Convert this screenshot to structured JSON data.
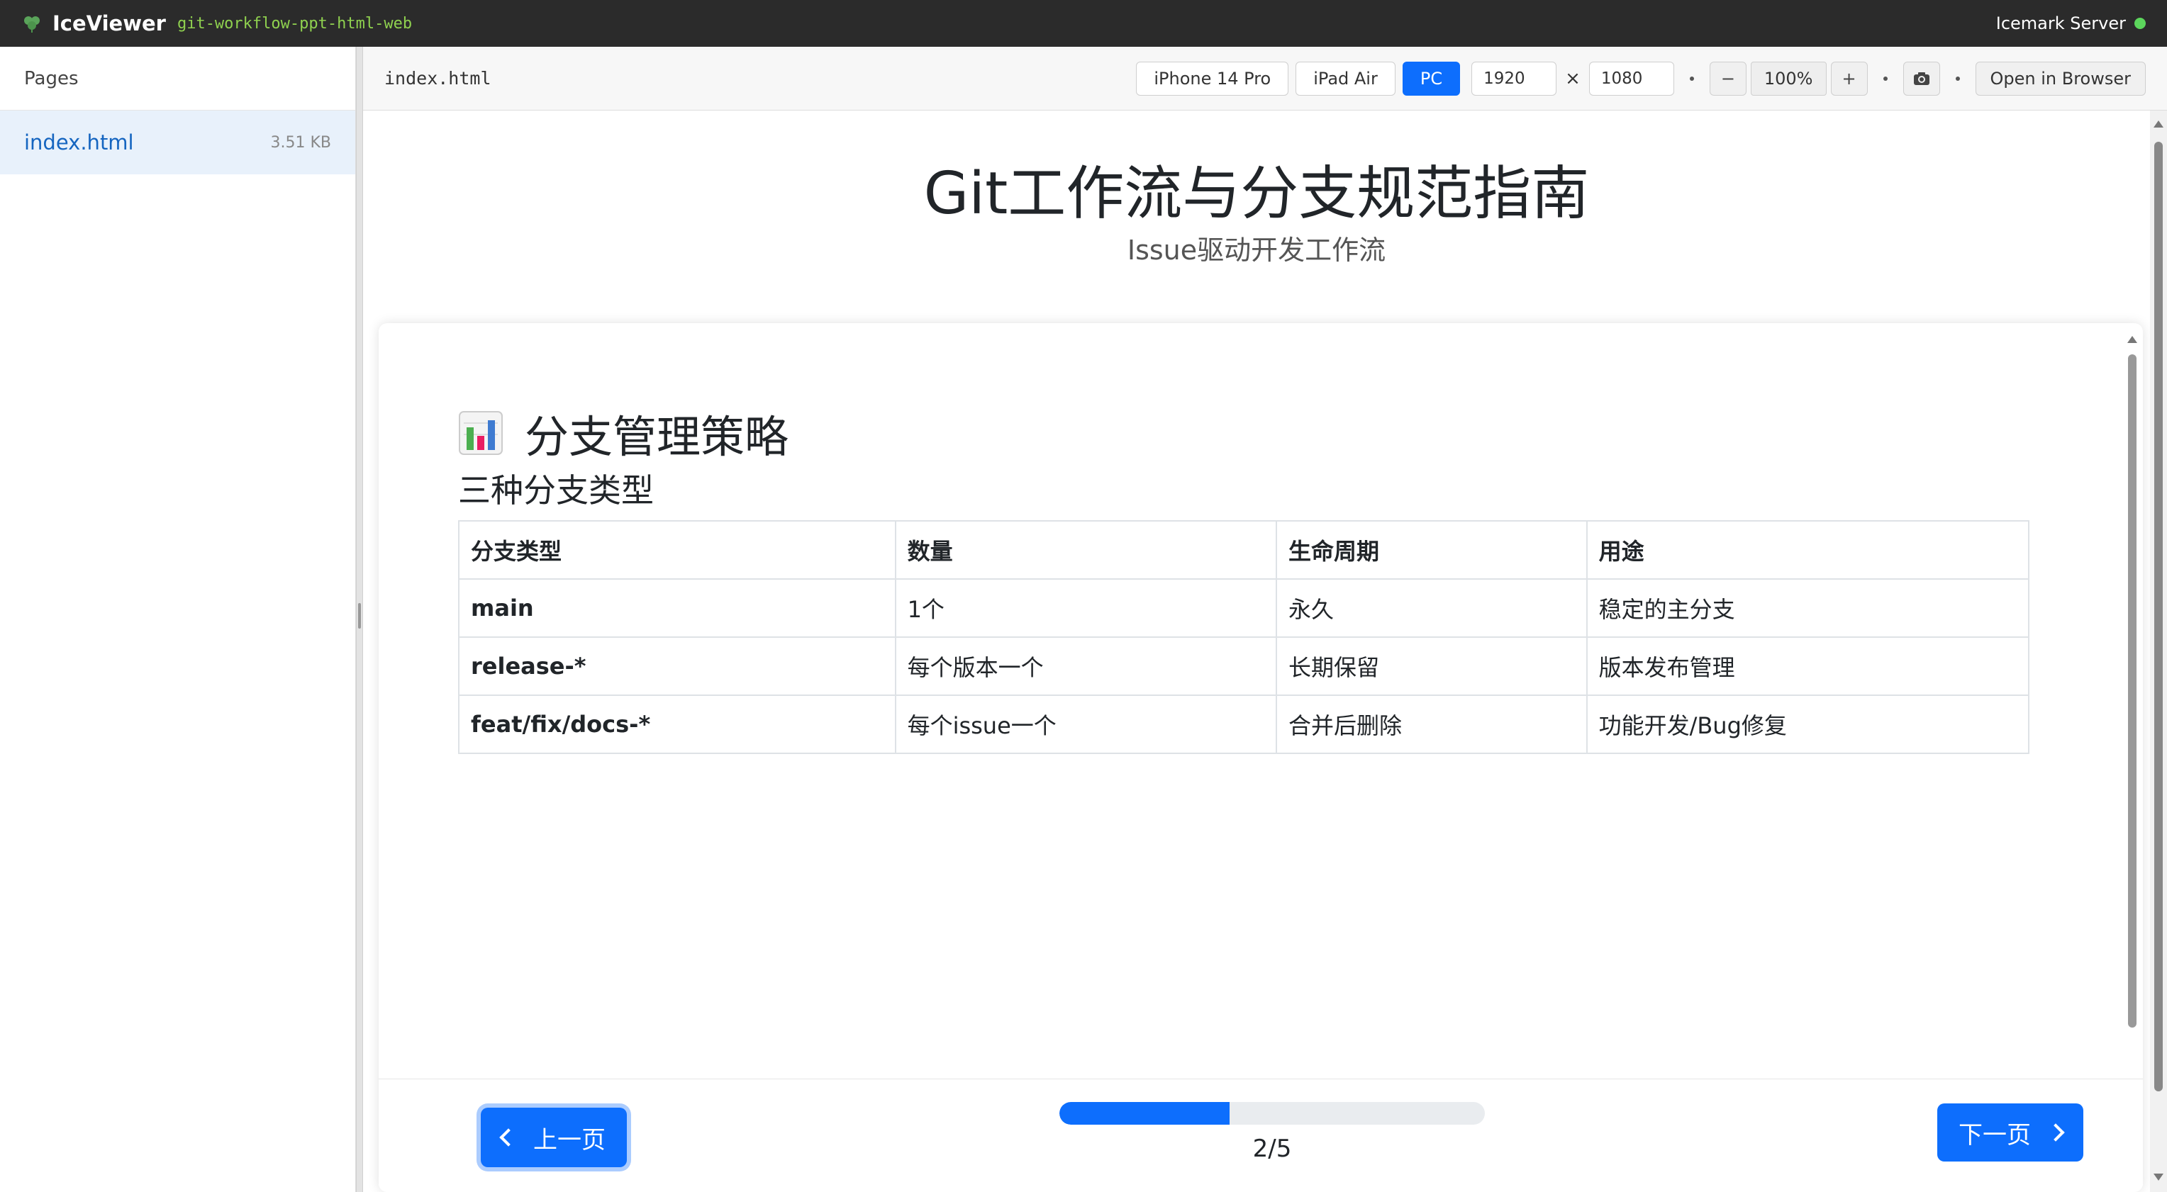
{
  "topbar": {
    "app_name": "IceViewer",
    "project": "git-workflow-ppt-html-web",
    "server": "Icemark Server",
    "server_status_color": "#5cd65c"
  },
  "sidebar": {
    "header": "Pages",
    "items": [
      {
        "label": "index.html",
        "size": "3.51 KB"
      }
    ]
  },
  "toolbar": {
    "file": "index.html",
    "devices": [
      "iPhone 14 Pro",
      "iPad Air",
      "PC"
    ],
    "active_device": "PC",
    "width": "1920",
    "height": "1080",
    "size_separator": "×",
    "zoom_out": "−",
    "zoom": "100%",
    "zoom_in": "+",
    "open_browser": "Open in Browser"
  },
  "doc": {
    "title": "Git工作流与分支规范指南",
    "subtitle": "Issue驱动开发工作流"
  },
  "slide": {
    "heading": "分支管理策略",
    "heading_icon": "bar-chart-icon",
    "subheading": "三种分支类型",
    "table": {
      "headers": [
        "分支类型",
        "数量",
        "生命周期",
        "用途"
      ],
      "rows": [
        [
          "main",
          "1个",
          "永久",
          "稳定的主分支"
        ],
        [
          "release-*",
          "每个版本一个",
          "长期保留",
          "版本发布管理"
        ],
        [
          "feat/fix/docs-*",
          "每个issue一个",
          "合并后删除",
          "功能开发/Bug修复"
        ]
      ]
    }
  },
  "nav": {
    "prev": "上一页",
    "next": "下一页",
    "page": "2/5",
    "progress_fraction": 0.4
  },
  "colors": {
    "accent": "#0d6efd",
    "topbar": "#2b2b2b",
    "project": "#8fd14f"
  }
}
